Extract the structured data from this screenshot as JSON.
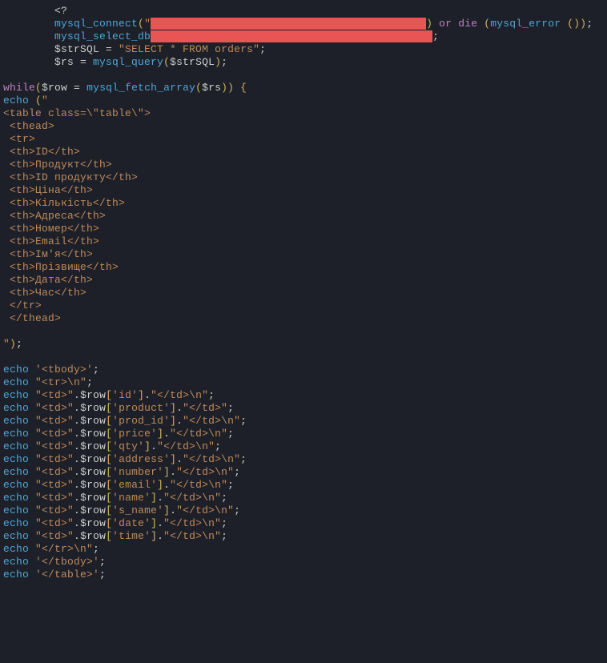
{
  "indent": "        ",
  "lines": [
    {
      "indent": 8,
      "raw": [
        {
          "t": "op",
          "v": "<?"
        }
      ]
    },
    {
      "indent": 8,
      "raw": [
        {
          "t": "fn",
          "v": "mysql_connect"
        },
        {
          "t": "paren",
          "v": "("
        },
        {
          "t": "str",
          "v": "\""
        },
        {
          "t": "redact",
          "v": "                                           "
        },
        {
          "t": "paren",
          "v": ")"
        },
        {
          "t": "op",
          "v": " "
        },
        {
          "t": "kw",
          "v": "or"
        },
        {
          "t": "op",
          "v": " "
        },
        {
          "t": "kw",
          "v": "die"
        },
        {
          "t": "op",
          "v": " "
        },
        {
          "t": "paren",
          "v": "("
        },
        {
          "t": "fn",
          "v": "mysql_error"
        },
        {
          "t": "op",
          "v": " "
        },
        {
          "t": "paren",
          "v": "()"
        },
        {
          "t": "paren",
          "v": ")"
        },
        {
          "t": "op",
          "v": ";"
        }
      ]
    },
    {
      "indent": 8,
      "raw": [
        {
          "t": "fn",
          "v": "mysql_select_db"
        },
        {
          "t": "redact",
          "v": "                                            "
        },
        {
          "t": "op",
          "v": ";"
        }
      ]
    },
    {
      "indent": 8,
      "raw": [
        {
          "t": "var",
          "v": "$strSQL"
        },
        {
          "t": "op",
          "v": " = "
        },
        {
          "t": "str",
          "v": "\"SELECT * FROM orders\""
        },
        {
          "t": "op",
          "v": ";"
        }
      ]
    },
    {
      "indent": 8,
      "raw": [
        {
          "t": "var",
          "v": "$rs"
        },
        {
          "t": "op",
          "v": " = "
        },
        {
          "t": "fn",
          "v": "mysql_query"
        },
        {
          "t": "paren",
          "v": "("
        },
        {
          "t": "var",
          "v": "$strSQL"
        },
        {
          "t": "paren",
          "v": ")"
        },
        {
          "t": "op",
          "v": ";"
        }
      ]
    },
    {
      "indent": 0,
      "raw": [
        {
          "t": "op",
          "v": ""
        }
      ]
    },
    {
      "indent": 0,
      "raw": [
        {
          "t": "whileK",
          "v": "while"
        },
        {
          "t": "paren",
          "v": "("
        },
        {
          "t": "var",
          "v": "$row"
        },
        {
          "t": "op",
          "v": " = "
        },
        {
          "t": "fn",
          "v": "mysql_fetch_array"
        },
        {
          "t": "paren",
          "v": "("
        },
        {
          "t": "var",
          "v": "$rs"
        },
        {
          "t": "paren",
          "v": ")"
        },
        {
          "t": "paren",
          "v": ")"
        },
        {
          "t": "op",
          "v": " "
        },
        {
          "t": "paren",
          "v": "{"
        }
      ]
    },
    {
      "indent": 0,
      "raw": [
        {
          "t": "echoK",
          "v": "echo"
        },
        {
          "t": "op",
          "v": " "
        },
        {
          "t": "paren",
          "v": "("
        },
        {
          "t": "str",
          "v": "\""
        }
      ]
    },
    {
      "indent": 0,
      "raw": [
        {
          "t": "str",
          "v": "<table class=\\\"table\\\">"
        }
      ]
    },
    {
      "indent": 0,
      "raw": [
        {
          "t": "str",
          "v": " <thead>"
        }
      ]
    },
    {
      "indent": 0,
      "raw": [
        {
          "t": "str",
          "v": " <tr>"
        }
      ]
    },
    {
      "indent": 0,
      "raw": [
        {
          "t": "str",
          "v": " <th>ID</th>"
        }
      ]
    },
    {
      "indent": 0,
      "raw": [
        {
          "t": "str",
          "v": " <th>Продукт</th>"
        }
      ]
    },
    {
      "indent": 0,
      "raw": [
        {
          "t": "str",
          "v": " <th>ID продукту</th>"
        }
      ]
    },
    {
      "indent": 0,
      "raw": [
        {
          "t": "str",
          "v": " <th>Ціна</th>"
        }
      ]
    },
    {
      "indent": 0,
      "raw": [
        {
          "t": "str",
          "v": " <th>Кількість</th>"
        }
      ]
    },
    {
      "indent": 0,
      "raw": [
        {
          "t": "str",
          "v": " <th>Адреса</th>"
        }
      ]
    },
    {
      "indent": 0,
      "raw": [
        {
          "t": "str",
          "v": " <th>Номер</th>"
        }
      ]
    },
    {
      "indent": 0,
      "raw": [
        {
          "t": "str",
          "v": " <th>Email</th>"
        }
      ]
    },
    {
      "indent": 0,
      "raw": [
        {
          "t": "str",
          "v": " <th>Ім'я</th>"
        }
      ]
    },
    {
      "indent": 0,
      "raw": [
        {
          "t": "str",
          "v": " <th>Прізвище</th>"
        }
      ]
    },
    {
      "indent": 0,
      "raw": [
        {
          "t": "str",
          "v": " <th>Дата</th>"
        }
      ]
    },
    {
      "indent": 0,
      "raw": [
        {
          "t": "str",
          "v": " <th>Час</th>"
        }
      ]
    },
    {
      "indent": 0,
      "raw": [
        {
          "t": "str",
          "v": " </tr>"
        }
      ]
    },
    {
      "indent": 0,
      "raw": [
        {
          "t": "str",
          "v": " </thead>"
        }
      ]
    },
    {
      "indent": 0,
      "raw": [
        {
          "t": "op",
          "v": ""
        }
      ]
    },
    {
      "indent": 0,
      "raw": [
        {
          "t": "str",
          "v": "\""
        },
        {
          "t": "paren",
          "v": ")"
        },
        {
          "t": "op",
          "v": ";"
        }
      ]
    },
    {
      "indent": 0,
      "raw": [
        {
          "t": "op",
          "v": ""
        }
      ]
    },
    {
      "indent": 0,
      "raw": [
        {
          "t": "echoK",
          "v": "echo"
        },
        {
          "t": "op",
          "v": " "
        },
        {
          "t": "sq",
          "v": "'<tbody>'"
        },
        {
          "t": "op",
          "v": ";"
        }
      ]
    },
    {
      "indent": 0,
      "raw": [
        {
          "t": "echoK",
          "v": "echo"
        },
        {
          "t": "op",
          "v": " "
        },
        {
          "t": "str",
          "v": "\"<tr>\\n\""
        },
        {
          "t": "op",
          "v": ";"
        }
      ]
    },
    {
      "indent": 0,
      "raw": [
        {
          "t": "echoK",
          "v": "echo"
        },
        {
          "t": "op",
          "v": " "
        },
        {
          "t": "str",
          "v": "\"<td>\""
        },
        {
          "t": "op",
          "v": "."
        },
        {
          "t": "var",
          "v": "$row"
        },
        {
          "t": "paren",
          "v": "["
        },
        {
          "t": "sq",
          "v": "'id'"
        },
        {
          "t": "paren",
          "v": "]"
        },
        {
          "t": "op",
          "v": "."
        },
        {
          "t": "str",
          "v": "\"</td>\\n\""
        },
        {
          "t": "op",
          "v": ";"
        }
      ]
    },
    {
      "indent": 0,
      "raw": [
        {
          "t": "echoK",
          "v": "echo"
        },
        {
          "t": "op",
          "v": " "
        },
        {
          "t": "str",
          "v": "\"<td>\""
        },
        {
          "t": "op",
          "v": "."
        },
        {
          "t": "var",
          "v": "$row"
        },
        {
          "t": "paren",
          "v": "["
        },
        {
          "t": "sq",
          "v": "'product'"
        },
        {
          "t": "paren",
          "v": "]"
        },
        {
          "t": "op",
          "v": "."
        },
        {
          "t": "str",
          "v": "\"</td>\""
        },
        {
          "t": "op",
          "v": ";"
        }
      ]
    },
    {
      "indent": 0,
      "raw": [
        {
          "t": "echoK",
          "v": "echo"
        },
        {
          "t": "op",
          "v": " "
        },
        {
          "t": "str",
          "v": "\"<td>\""
        },
        {
          "t": "op",
          "v": "."
        },
        {
          "t": "var",
          "v": "$row"
        },
        {
          "t": "paren",
          "v": "["
        },
        {
          "t": "sq",
          "v": "'prod_id'"
        },
        {
          "t": "paren",
          "v": "]"
        },
        {
          "t": "op",
          "v": "."
        },
        {
          "t": "str",
          "v": "\"</td>\\n\""
        },
        {
          "t": "op",
          "v": ";"
        }
      ]
    },
    {
      "indent": 0,
      "raw": [
        {
          "t": "echoK",
          "v": "echo"
        },
        {
          "t": "op",
          "v": " "
        },
        {
          "t": "str",
          "v": "\"<td>\""
        },
        {
          "t": "op",
          "v": "."
        },
        {
          "t": "var",
          "v": "$row"
        },
        {
          "t": "paren",
          "v": "["
        },
        {
          "t": "sq",
          "v": "'price'"
        },
        {
          "t": "paren",
          "v": "]"
        },
        {
          "t": "op",
          "v": "."
        },
        {
          "t": "str",
          "v": "\"</td>\\n\""
        },
        {
          "t": "op",
          "v": ";"
        }
      ]
    },
    {
      "indent": 0,
      "raw": [
        {
          "t": "echoK",
          "v": "echo"
        },
        {
          "t": "op",
          "v": " "
        },
        {
          "t": "str",
          "v": "\"<td>\""
        },
        {
          "t": "op",
          "v": "."
        },
        {
          "t": "var",
          "v": "$row"
        },
        {
          "t": "paren",
          "v": "["
        },
        {
          "t": "sq",
          "v": "'qty'"
        },
        {
          "t": "paren",
          "v": "]"
        },
        {
          "t": "op",
          "v": "."
        },
        {
          "t": "str",
          "v": "\"</td>\\n\""
        },
        {
          "t": "op",
          "v": ";"
        }
      ]
    },
    {
      "indent": 0,
      "raw": [
        {
          "t": "echoK",
          "v": "echo"
        },
        {
          "t": "op",
          "v": " "
        },
        {
          "t": "str",
          "v": "\"<td>\""
        },
        {
          "t": "op",
          "v": "."
        },
        {
          "t": "var",
          "v": "$row"
        },
        {
          "t": "paren",
          "v": "["
        },
        {
          "t": "sq",
          "v": "'address'"
        },
        {
          "t": "paren",
          "v": "]"
        },
        {
          "t": "op",
          "v": "."
        },
        {
          "t": "str",
          "v": "\"</td>\\n\""
        },
        {
          "t": "op",
          "v": ";"
        }
      ]
    },
    {
      "indent": 0,
      "raw": [
        {
          "t": "echoK",
          "v": "echo"
        },
        {
          "t": "op",
          "v": " "
        },
        {
          "t": "str",
          "v": "\"<td>\""
        },
        {
          "t": "op",
          "v": "."
        },
        {
          "t": "var",
          "v": "$row"
        },
        {
          "t": "paren",
          "v": "["
        },
        {
          "t": "sq",
          "v": "'number'"
        },
        {
          "t": "paren",
          "v": "]"
        },
        {
          "t": "op",
          "v": "."
        },
        {
          "t": "str",
          "v": "\"</td>\\n\""
        },
        {
          "t": "op",
          "v": ";"
        }
      ]
    },
    {
      "indent": 0,
      "raw": [
        {
          "t": "echoK",
          "v": "echo"
        },
        {
          "t": "op",
          "v": " "
        },
        {
          "t": "str",
          "v": "\"<td>\""
        },
        {
          "t": "op",
          "v": "."
        },
        {
          "t": "var",
          "v": "$row"
        },
        {
          "t": "paren",
          "v": "["
        },
        {
          "t": "sq",
          "v": "'email'"
        },
        {
          "t": "paren",
          "v": "]"
        },
        {
          "t": "op",
          "v": "."
        },
        {
          "t": "str",
          "v": "\"</td>\\n\""
        },
        {
          "t": "op",
          "v": ";"
        }
      ]
    },
    {
      "indent": 0,
      "raw": [
        {
          "t": "echoK",
          "v": "echo"
        },
        {
          "t": "op",
          "v": " "
        },
        {
          "t": "str",
          "v": "\"<td>\""
        },
        {
          "t": "op",
          "v": "."
        },
        {
          "t": "var",
          "v": "$row"
        },
        {
          "t": "paren",
          "v": "["
        },
        {
          "t": "sq",
          "v": "'name'"
        },
        {
          "t": "paren",
          "v": "]"
        },
        {
          "t": "op",
          "v": "."
        },
        {
          "t": "str",
          "v": "\"</td>\\n\""
        },
        {
          "t": "op",
          "v": ";"
        }
      ]
    },
    {
      "indent": 0,
      "raw": [
        {
          "t": "echoK",
          "v": "echo"
        },
        {
          "t": "op",
          "v": " "
        },
        {
          "t": "str",
          "v": "\"<td>\""
        },
        {
          "t": "op",
          "v": "."
        },
        {
          "t": "var",
          "v": "$row"
        },
        {
          "t": "paren",
          "v": "["
        },
        {
          "t": "sq",
          "v": "'s_name'"
        },
        {
          "t": "paren",
          "v": "]"
        },
        {
          "t": "op",
          "v": "."
        },
        {
          "t": "str",
          "v": "\"</td>\\n\""
        },
        {
          "t": "op",
          "v": ";"
        }
      ]
    },
    {
      "indent": 0,
      "raw": [
        {
          "t": "echoK",
          "v": "echo"
        },
        {
          "t": "op",
          "v": " "
        },
        {
          "t": "str",
          "v": "\"<td>\""
        },
        {
          "t": "op",
          "v": "."
        },
        {
          "t": "var",
          "v": "$row"
        },
        {
          "t": "paren",
          "v": "["
        },
        {
          "t": "sq",
          "v": "'date'"
        },
        {
          "t": "paren",
          "v": "]"
        },
        {
          "t": "op",
          "v": "."
        },
        {
          "t": "str",
          "v": "\"</td>\\n\""
        },
        {
          "t": "op",
          "v": ";"
        }
      ]
    },
    {
      "indent": 0,
      "raw": [
        {
          "t": "echoK",
          "v": "echo"
        },
        {
          "t": "op",
          "v": " "
        },
        {
          "t": "str",
          "v": "\"<td>\""
        },
        {
          "t": "op",
          "v": "."
        },
        {
          "t": "var",
          "v": "$row"
        },
        {
          "t": "paren",
          "v": "["
        },
        {
          "t": "sq",
          "v": "'time'"
        },
        {
          "t": "paren",
          "v": "]"
        },
        {
          "t": "op",
          "v": "."
        },
        {
          "t": "str",
          "v": "\"</td>\\n\""
        },
        {
          "t": "op",
          "v": ";"
        }
      ]
    },
    {
      "indent": 0,
      "raw": [
        {
          "t": "echoK",
          "v": "echo"
        },
        {
          "t": "op",
          "v": " "
        },
        {
          "t": "str",
          "v": "\"</tr>\\n\""
        },
        {
          "t": "op",
          "v": ";"
        }
      ]
    },
    {
      "indent": 0,
      "raw": [
        {
          "t": "echoK",
          "v": "echo"
        },
        {
          "t": "op",
          "v": " "
        },
        {
          "t": "sq",
          "v": "'</tbody>'"
        },
        {
          "t": "op",
          "v": ";"
        }
      ]
    },
    {
      "indent": 0,
      "raw": [
        {
          "t": "echoK",
          "v": "echo"
        },
        {
          "t": "op",
          "v": " "
        },
        {
          "t": "sq",
          "v": "'</table>'"
        },
        {
          "t": "op",
          "v": ";"
        }
      ]
    }
  ],
  "token_classes": {
    "kw": "kw",
    "fn": "fn",
    "str": "str",
    "var": "var",
    "op": "op",
    "punct": "punct",
    "paren": "paren",
    "ctrl": "ctrl",
    "echoK": "echoK",
    "whileK": "whileK",
    "sq": "sq",
    "redact": "redact"
  }
}
